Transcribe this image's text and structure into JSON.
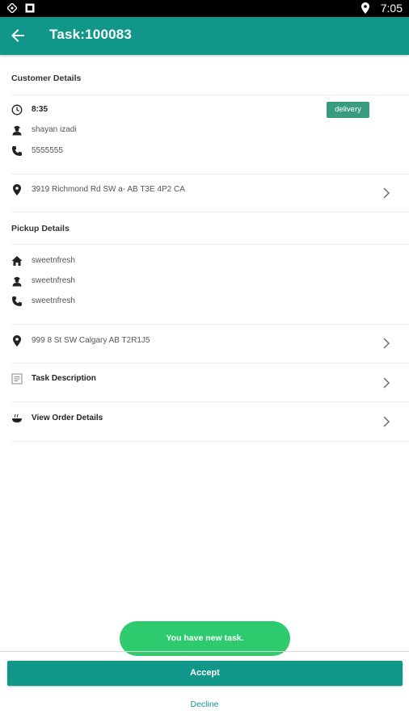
{
  "status_bar": {
    "time": "7:05"
  },
  "app_bar": {
    "title": "Task:100083"
  },
  "customer": {
    "header": "Customer Details",
    "time": "8:35",
    "type_badge": "delivery",
    "name": "shayan izadi",
    "phone": "5555555",
    "address": "3919 Richmond Rd SW a- AB T3E 4P2 CA"
  },
  "pickup": {
    "header": "Pickup Details",
    "store": "sweetnfresh",
    "contact": "sweetnfresh",
    "phone": "sweetnfresh",
    "address": "999 8 St SW Calgary AB T2R1J5"
  },
  "links": {
    "task_description": "Task Description",
    "view_order_details": "View Order Details"
  },
  "toast": "You have new task.",
  "actions": {
    "accept": "Accept",
    "decline": "Decline"
  },
  "colors": {
    "primary": "#11978a",
    "badge": "#3a9c7f",
    "toast": "#2ecb6e"
  }
}
